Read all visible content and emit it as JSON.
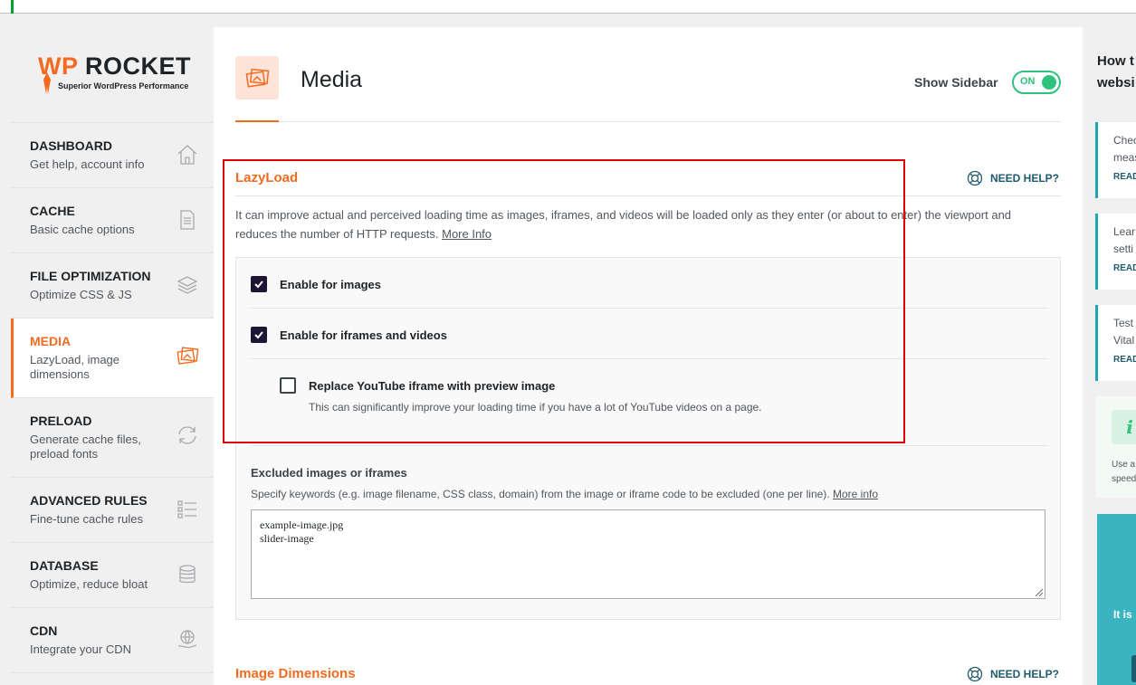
{
  "brand": {
    "name_wp": "WP",
    "name_rocket": "ROCKET",
    "tagline": "Superior WordPress Performance"
  },
  "nav": [
    {
      "title": "DASHBOARD",
      "sub": "Get help, account info",
      "icon": "house-icon"
    },
    {
      "title": "CACHE",
      "sub": "Basic cache options",
      "icon": "file-icon"
    },
    {
      "title": "FILE OPTIMIZATION",
      "sub": "Optimize CSS & JS",
      "icon": "layers-icon"
    },
    {
      "title": "MEDIA",
      "sub": "LazyLoad, image dimensions",
      "icon": "images-icon",
      "active": true
    },
    {
      "title": "PRELOAD",
      "sub": "Generate cache files, preload fonts",
      "icon": "refresh-icon"
    },
    {
      "title": "ADVANCED RULES",
      "sub": "Fine-tune cache rules",
      "icon": "list-icon"
    },
    {
      "title": "DATABASE",
      "sub": "Optimize, reduce bloat",
      "icon": "database-icon"
    },
    {
      "title": "CDN",
      "sub": "Integrate your CDN",
      "icon": "globe-hand-icon"
    }
  ],
  "header": {
    "title": "Media",
    "show_sidebar_label": "Show Sidebar",
    "toggle_label": "ON"
  },
  "lazyload": {
    "title": "LazyLoad",
    "need_help": "NEED HELP?",
    "description": "It can improve actual and perceived loading time as images, iframes, and videos will be loaded only as they enter (or about to enter) the viewport and reduces the number of HTTP requests.",
    "more_info": "More Info",
    "options": [
      {
        "label": "Enable for images",
        "checked": true
      },
      {
        "label": "Enable for iframes and videos",
        "checked": true
      },
      {
        "label": "Replace YouTube iframe with preview image",
        "checked": false,
        "description": "This can significantly improve your loading time if you have a lot of YouTube videos on a page."
      }
    ],
    "excluded": {
      "title": "Excluded images or iframes",
      "description": "Specify keywords (e.g. image filename, CSS class, domain) from the image or iframe code to be excluded (one per line).",
      "more_info": "More info",
      "line1": "example-image.jpg",
      "line2": "slider-image"
    }
  },
  "image_dimensions": {
    "title": "Image Dimensions",
    "need_help": "NEED HELP?"
  },
  "right_sidebar": {
    "heading_line1": "How t",
    "heading_line2": "websi",
    "cards": [
      {
        "line1": "Chec",
        "line2": "meas",
        "read": "READ"
      },
      {
        "line1": "Lear",
        "line2": "setti",
        "read": "READ"
      },
      {
        "line1": "Test",
        "line2": "Vital",
        "read": "READ"
      }
    ],
    "info_icon": "i",
    "info_line1": "Use a",
    "info_line2": "speed",
    "teal_text": "It is"
  },
  "colors": {
    "accent": "#f26b21",
    "toggle_green": "#2ec27e",
    "highlight_red": "#e00000",
    "checkbox_dark": "#1d1533"
  }
}
